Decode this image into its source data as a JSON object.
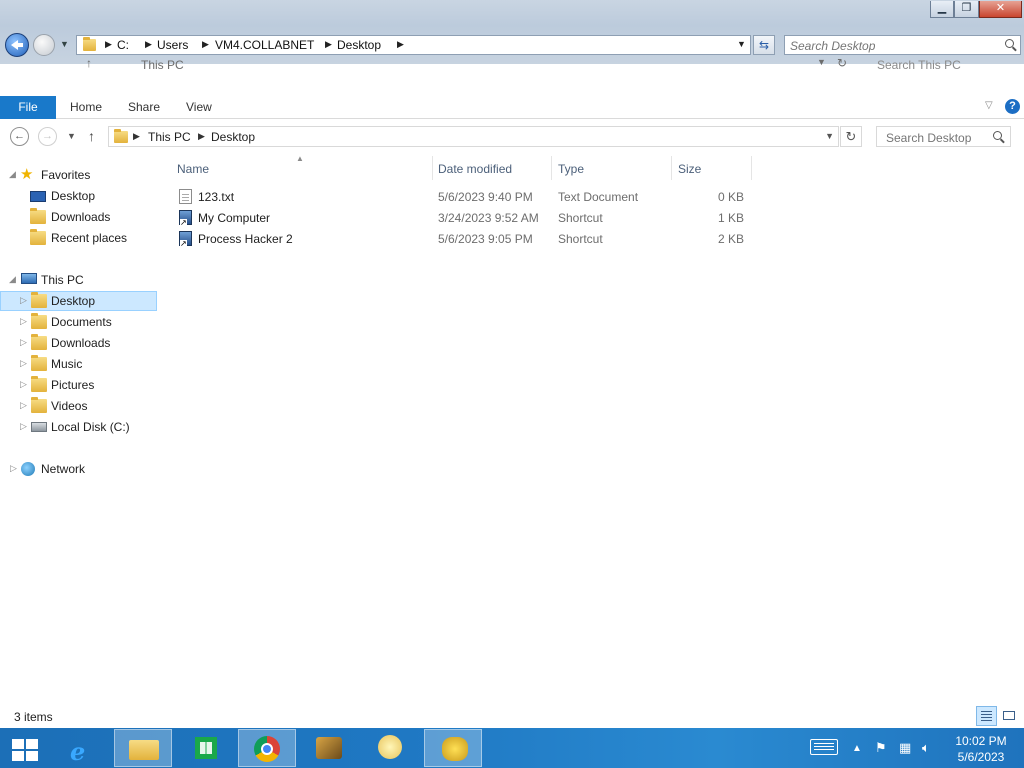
{
  "old_window": {
    "address": [
      "C:",
      "Users",
      "VM4.COLLABNET",
      "Desktop"
    ],
    "search_placeholder": "Search Desktop"
  },
  "ghost": {
    "location": "This PC",
    "search": "Search This PC"
  },
  "ribbon": {
    "tabs": [
      "File",
      "Home",
      "Share",
      "View"
    ]
  },
  "navbar": {
    "address": [
      "This PC",
      "Desktop"
    ],
    "search_placeholder": "Search Desktop"
  },
  "nav_pane": {
    "favorites_label": "Favorites",
    "favorites": [
      "Desktop",
      "Downloads",
      "Recent places"
    ],
    "this_pc_label": "This PC",
    "this_pc": [
      "Desktop",
      "Documents",
      "Downloads",
      "Music",
      "Pictures",
      "Videos",
      "Local Disk (C:)"
    ],
    "network_label": "Network"
  },
  "columns": {
    "name": "Name",
    "date": "Date modified",
    "type": "Type",
    "size": "Size"
  },
  "files": [
    {
      "name": "123.txt",
      "date": "5/6/2023 9:40 PM",
      "type": "Text Document",
      "size": "0 KB",
      "icon": "text-file-icon"
    },
    {
      "name": "My Computer",
      "date": "3/24/2023 9:52 AM",
      "type": "Shortcut",
      "size": "1 KB",
      "icon": "shortcut-icon"
    },
    {
      "name": "Process Hacker 2",
      "date": "5/6/2023 9:05 PM",
      "type": "Shortcut",
      "size": "2 KB",
      "icon": "shortcut-icon"
    }
  ],
  "status": {
    "item_count": "3 items"
  },
  "taskbar": {
    "apps": [
      "internet-explorer-icon",
      "file-explorer-icon",
      "store-icon",
      "chrome-icon",
      "app-icon",
      "app-icon",
      "app-icon"
    ],
    "time": "10:02 PM",
    "date": "5/6/2023"
  },
  "colors": {
    "accent": "#1979ca",
    "selection": "#cce8ff",
    "taskbar": "#1f78c3"
  }
}
